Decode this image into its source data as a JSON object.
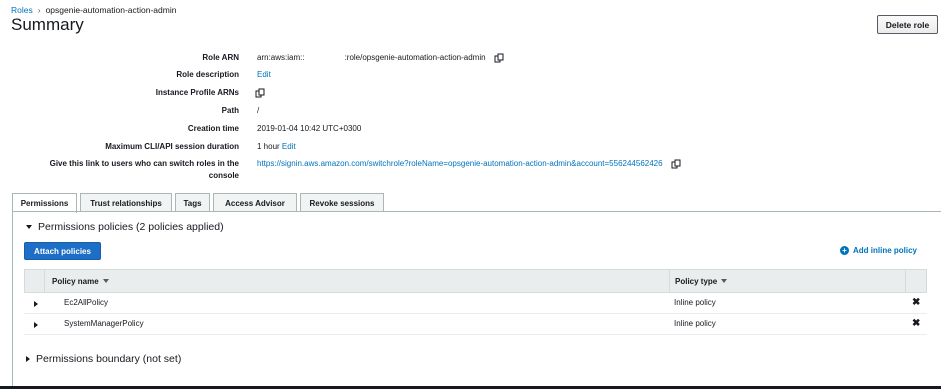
{
  "breadcrumb": {
    "parent": "Roles",
    "current": "opsgenie-automation-action-admin"
  },
  "page_title": "Summary",
  "delete_button": "Delete role",
  "summary": {
    "role_arn": {
      "label": "Role ARN",
      "value": "arn:aws:iam::     :role/opsgenie-automation-action-admin"
    },
    "role_description": {
      "label": "Role description",
      "value": "Edit"
    },
    "instance_profile": {
      "label": "Instance Profile ARNs"
    },
    "path": {
      "label": "Path",
      "value": "/"
    },
    "creation_time": {
      "label": "Creation time",
      "value": "2019-01-04 10:42 UTC+0300"
    },
    "session_duration": {
      "label": "Maximum CLI/API session duration",
      "value": "1 hour",
      "edit": "Edit"
    },
    "switch_link": {
      "label_line1": "Give this link to users who can switch roles in the",
      "label_line2": "console",
      "value": "https://signin.aws.amazon.com/switchrole?roleName=opsgenie-automation-action-admin&account=556244562426"
    }
  },
  "tabs": [
    {
      "label": "Permissions",
      "active": true
    },
    {
      "label": "Trust relationships"
    },
    {
      "label": "Tags"
    },
    {
      "label": "Access Advisor"
    },
    {
      "label": "Revoke sessions"
    }
  ],
  "permissions": {
    "section_title": "Permissions policies (2 policies applied)",
    "attach_button": "Attach policies",
    "add_inline": "Add inline policy",
    "columns": {
      "name": "Policy name",
      "type": "Policy type"
    },
    "rows": [
      {
        "name": "Ec2AllPolicy",
        "type": "Inline policy"
      },
      {
        "name": "SystemManagerPolicy",
        "type": "Inline policy"
      }
    ],
    "boundary_title": "Permissions boundary (not set)"
  },
  "colors": {
    "link": "#0073bb",
    "primary_button": "#1d6ec6",
    "header_bg": "#eaeded"
  }
}
